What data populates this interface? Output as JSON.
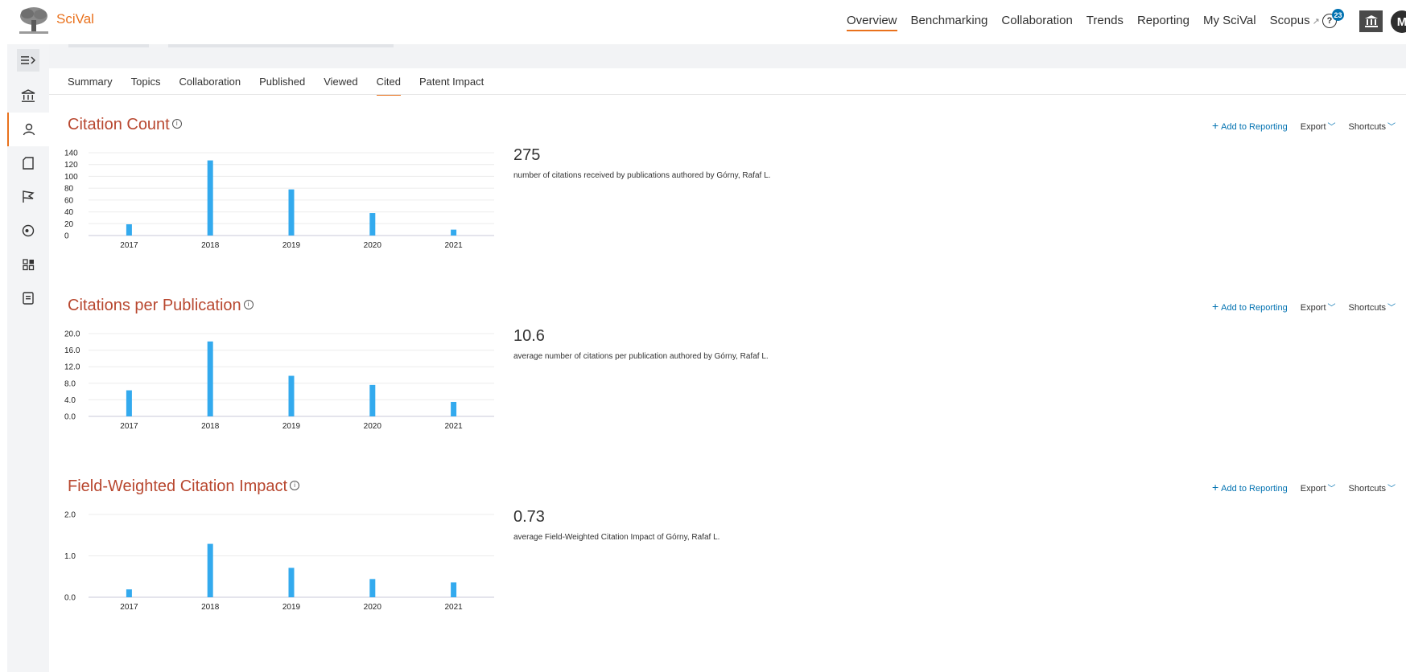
{
  "app": {
    "brand": "SciVal"
  },
  "nav": {
    "items": [
      "Overview",
      "Benchmarking",
      "Collaboration",
      "Trends",
      "Reporting",
      "My SciVal",
      "Scopus"
    ],
    "active": "Overview",
    "external_arrow": "↗"
  },
  "header": {
    "help_badge": "23",
    "avatar": "M"
  },
  "tabs": {
    "items": [
      "Summary",
      "Topics",
      "Collaboration",
      "Published",
      "Viewed",
      "Cited",
      "Patent Impact"
    ],
    "active": "Cited"
  },
  "actions": {
    "add_label": "Add to Reporting",
    "export_label": "Export",
    "shortcuts_label": "Shortcuts"
  },
  "colors": {
    "accent": "#e9711c",
    "title": "#b8472f",
    "bar": "#33aaee",
    "link": "#0272b1"
  },
  "metrics": [
    {
      "title": "Citation Count",
      "value": "275",
      "description": "number of citations received by publications authored by Górny, Rafaf L."
    },
    {
      "title": "Citations per Publication",
      "value": "10.6",
      "description": "average number of citations per publication authored by Górny, Rafaf L."
    },
    {
      "title": "Field-Weighted Citation Impact",
      "value": "0.73",
      "description": "average Field-Weighted Citation Impact of Górny, Rafaf L."
    }
  ],
  "chart_data": [
    {
      "type": "bar",
      "categories": [
        "2017",
        "2018",
        "2019",
        "2020",
        "2021"
      ],
      "values": [
        19,
        127,
        78,
        38,
        10
      ],
      "ylim": [
        0,
        140
      ],
      "yticks": [
        "0",
        "20",
        "40",
        "60",
        "80",
        "100",
        "120",
        "140"
      ]
    },
    {
      "type": "bar",
      "categories": [
        "2017",
        "2018",
        "2019",
        "2020",
        "2021"
      ],
      "values": [
        6.3,
        18.1,
        9.8,
        7.6,
        3.5
      ],
      "ylim": [
        0,
        20
      ],
      "yticks": [
        "0.0",
        "4.0",
        "8.0",
        "12.0",
        "16.0",
        "20.0"
      ]
    },
    {
      "type": "bar",
      "categories": [
        "2017",
        "2018",
        "2019",
        "2020",
        "2021"
      ],
      "values": [
        0.19,
        1.29,
        0.71,
        0.44,
        0.36
      ],
      "ylim": [
        0,
        2
      ],
      "yticks": [
        "0.0",
        "1.0",
        "2.0"
      ]
    }
  ]
}
